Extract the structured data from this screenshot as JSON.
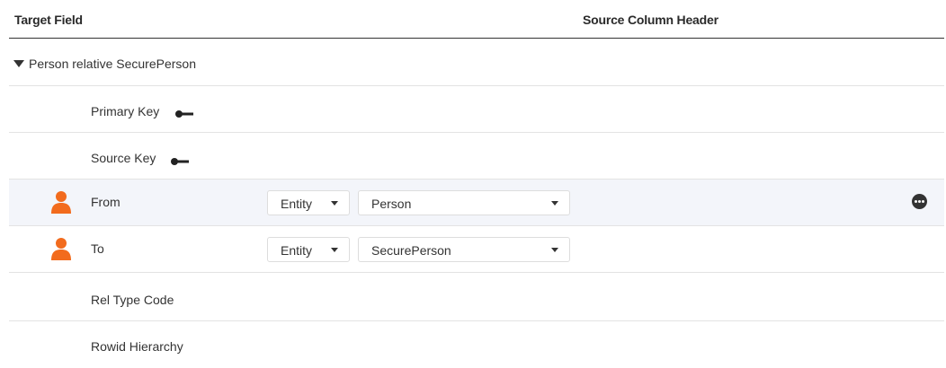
{
  "header": {
    "target_field": "Target Field",
    "source_column_header": "Source Column Header"
  },
  "group": {
    "label": "Person relative SecurePerson",
    "expanded": true
  },
  "rows": {
    "primary_key": {
      "label": "Primary Key",
      "icon": "key-icon"
    },
    "source_key": {
      "label": "Source Key",
      "icon": "key-icon"
    },
    "from": {
      "label": "From",
      "icon": "person-icon",
      "entity_select": "Entity",
      "value_select": "Person",
      "more_icon": "more-options-icon"
    },
    "to": {
      "label": "To",
      "icon": "person-icon",
      "entity_select": "Entity",
      "value_select": "SecurePerson"
    },
    "rel_type_code": {
      "label": "Rel Type Code"
    },
    "rowid_hierarchy": {
      "label": "Rowid Hierarchy"
    }
  },
  "colors": {
    "accent_orange": "#F26B1D",
    "highlight_row": "#f3f5fa",
    "text": "#333333"
  }
}
